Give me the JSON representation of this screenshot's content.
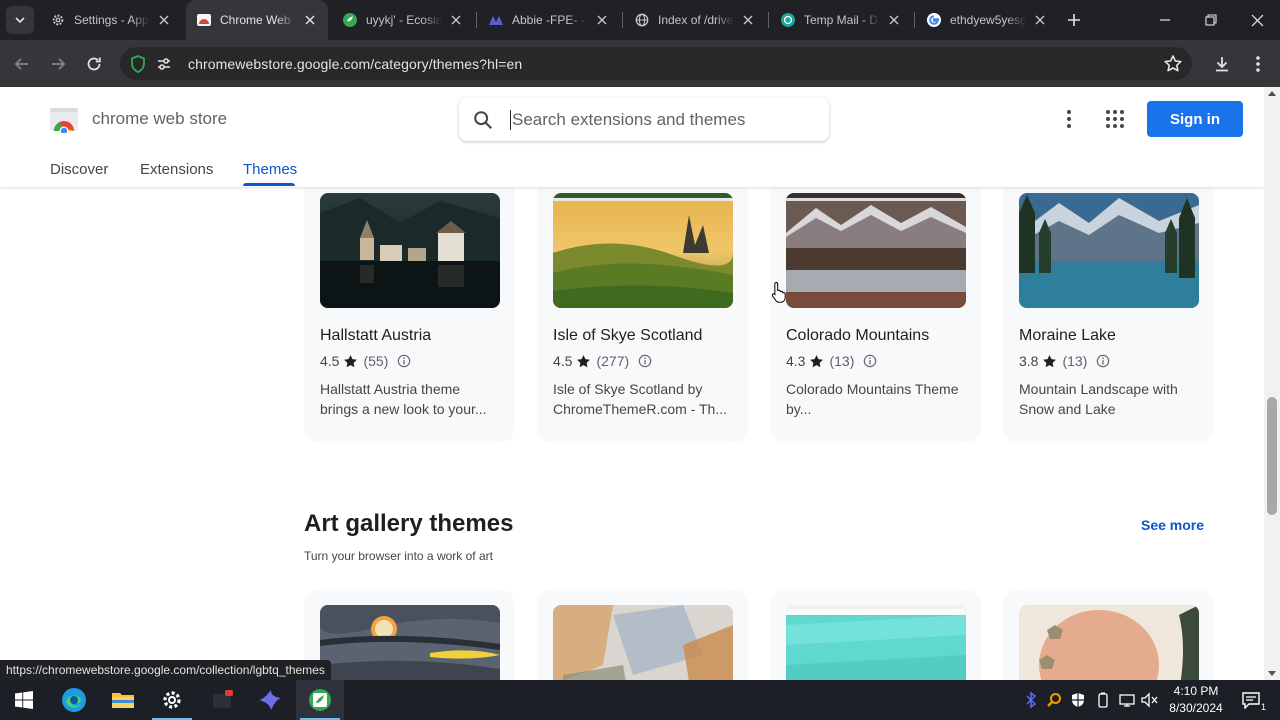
{
  "browser": {
    "tabs": [
      {
        "title": "Settings - App",
        "favicon": "gear-icon",
        "active": false
      },
      {
        "title": "Chrome Web",
        "favicon": "chrome-web-store-icon",
        "active": true
      },
      {
        "title": "uyykj' - Ecosia",
        "favicon": "ecosia-icon",
        "active": false
      },
      {
        "title": "Abbie -FPE- -",
        "favicon": "app-logo-icon",
        "active": false
      },
      {
        "title": "Index of /drive",
        "favicon": "globe-icon",
        "active": false
      },
      {
        "title": "Temp Mail - D",
        "favicon": "temp-mail-icon",
        "active": false
      },
      {
        "title": "ethdyew5yesg",
        "favicon": "google-icon",
        "active": false
      }
    ],
    "url": "chromewebstore.google.com/category/themes?hl=en",
    "status_url": "https://chromewebstore.google.com/collection/lgbtq_themes"
  },
  "store": {
    "name": "chrome web store",
    "search_placeholder": "Search extensions and themes",
    "sign_in": "Sign in",
    "nav": [
      {
        "label": "Discover",
        "active": false
      },
      {
        "label": "Extensions",
        "active": false
      },
      {
        "label": "Themes",
        "active": true
      }
    ]
  },
  "cards": [
    {
      "title": "Hallstatt Austria",
      "rating": "4.5",
      "count": "(55)",
      "desc": "Hallstatt Austria theme brings a new look to your..."
    },
    {
      "title": "Isle of Skye Scotland",
      "rating": "4.5",
      "count": "(277)",
      "desc": "Isle of Skye Scotland by ChromeThemeR.com - Th..."
    },
    {
      "title": "Colorado Mountains",
      "rating": "4.3",
      "count": "(13)",
      "desc": "Colorado Mountains Theme by..."
    },
    {
      "title": "Moraine Lake",
      "rating": "3.8",
      "count": "(13)",
      "desc": "Mountain Landscape with Snow and Lake"
    }
  ],
  "section": {
    "title": "Art gallery themes",
    "subtitle": "Turn your browser into a work of art",
    "see_more": "See more"
  },
  "taskbar": {
    "time": "4:10 PM",
    "date": "8/30/2024",
    "notification_count": "1"
  },
  "colors": {
    "accent": "#0b57d0",
    "sign_in_bg": "#1a73e8",
    "tabstrip_bg": "#202124",
    "toolbar_bg": "#35363a"
  }
}
